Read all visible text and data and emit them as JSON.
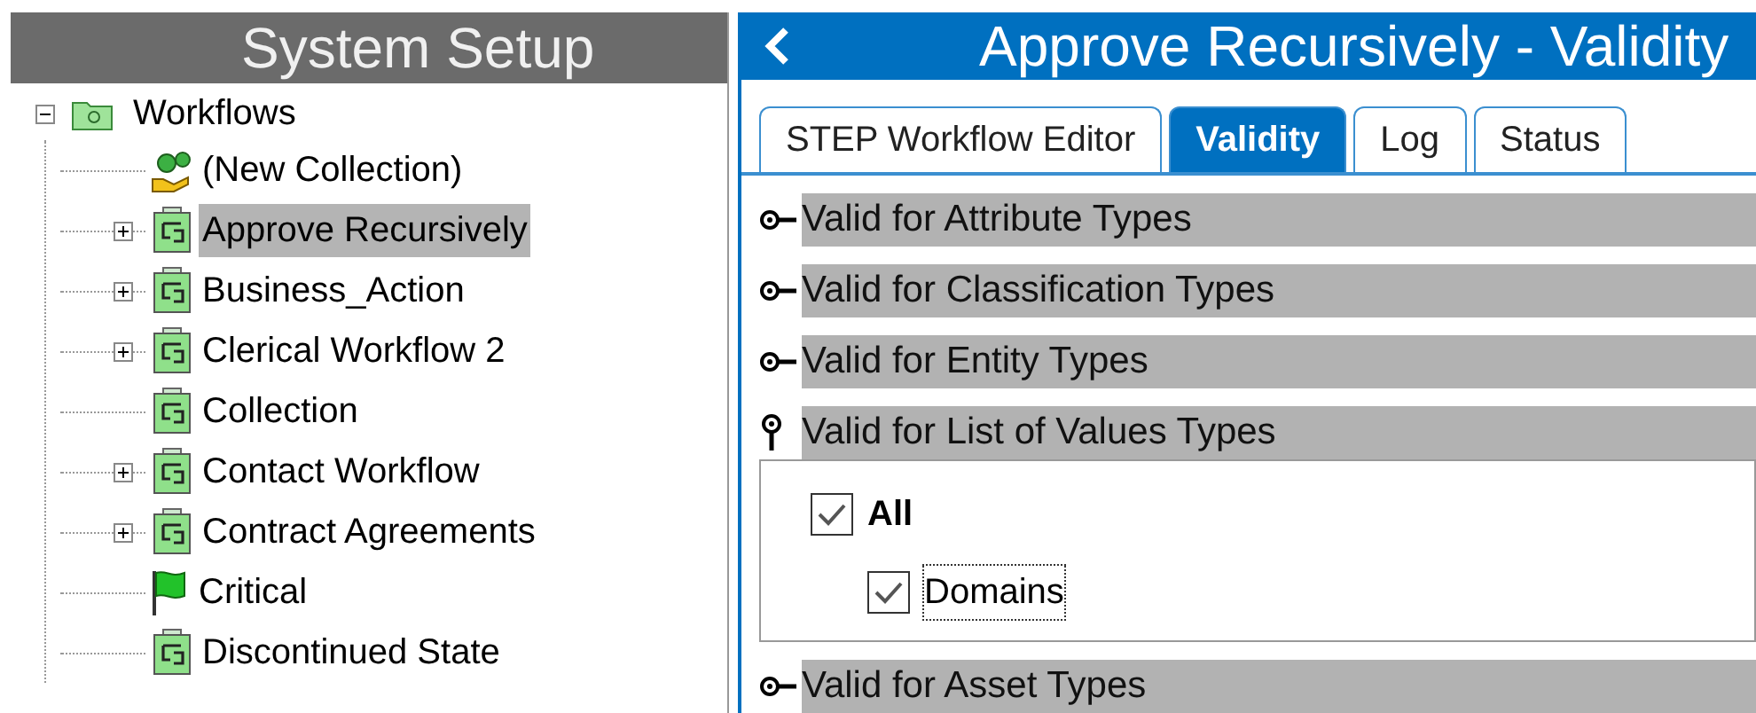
{
  "left_panel": {
    "title": "System Setup",
    "tree": [
      {
        "label": "Workflows",
        "kind": "folder",
        "expanded": true,
        "selected": false,
        "children": [
          {
            "label": "(New Collection)",
            "kind": "new",
            "expandable": false,
            "selected": false
          },
          {
            "label": "Approve Recursively",
            "kind": "workflow",
            "expandable": true,
            "selected": true
          },
          {
            "label": "Business_Action",
            "kind": "workflow",
            "expandable": true,
            "selected": false
          },
          {
            "label": "Clerical Workflow 2",
            "kind": "workflow",
            "expandable": true,
            "selected": false
          },
          {
            "label": "Collection",
            "kind": "workflow",
            "expandable": false,
            "selected": false
          },
          {
            "label": "Contact Workflow",
            "kind": "workflow",
            "expandable": true,
            "selected": false
          },
          {
            "label": "Contract Agreements",
            "kind": "workflow",
            "expandable": true,
            "selected": false
          },
          {
            "label": "Critical",
            "kind": "flag",
            "expandable": false,
            "selected": false
          },
          {
            "label": "Discontinued State",
            "kind": "workflow",
            "expandable": false,
            "selected": false
          }
        ]
      }
    ]
  },
  "right_panel": {
    "title": "Approve Recursively - Validity",
    "tabs": [
      {
        "label": "STEP Workflow Editor",
        "selected": false
      },
      {
        "label": "Validity",
        "selected": true
      },
      {
        "label": "Log",
        "selected": false
      },
      {
        "label": "Status",
        "selected": false
      }
    ],
    "sections": [
      {
        "label": "Valid for Attribute Types",
        "expanded": false
      },
      {
        "label": "Valid for Classification Types",
        "expanded": false
      },
      {
        "label": "Valid for Entity Types",
        "expanded": false
      },
      {
        "label": "Valid for List of Values Types",
        "expanded": true,
        "options": [
          {
            "label": "All",
            "checked": true,
            "kind": "all",
            "focused": false
          },
          {
            "label": "Domains",
            "checked": true,
            "kind": "item",
            "focused": true
          }
        ]
      },
      {
        "label": "Valid for Asset Types",
        "expanded": false
      }
    ]
  }
}
